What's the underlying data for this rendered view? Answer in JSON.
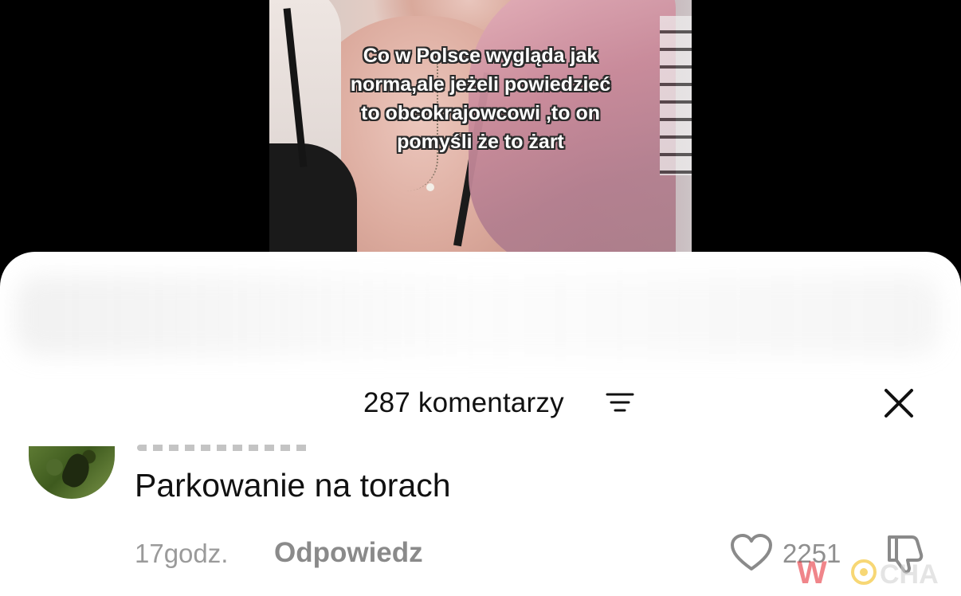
{
  "video": {
    "caption_lines": [
      "Co w Polsce wygląda jak",
      "norma,ale jeżeli powiedzieć",
      "to obcokrajowcowi ,to on",
      "pomyśli że to żart"
    ]
  },
  "comments_sheet": {
    "title": "287 komentarzy",
    "icons": {
      "filter": "filter-sort-icon",
      "close": "close-icon"
    }
  },
  "comment": {
    "text": "Parkowanie na torach",
    "time": "17godz.",
    "reply_label": "Odpowiedz",
    "like_count": "2251",
    "icons": {
      "like": "heart-icon",
      "dislike": "thumbs-down-icon"
    }
  },
  "watermark": {
    "text": "WIOCHA",
    "colors": {
      "w": "#e4232b",
      "sun": "#f2b705"
    }
  }
}
